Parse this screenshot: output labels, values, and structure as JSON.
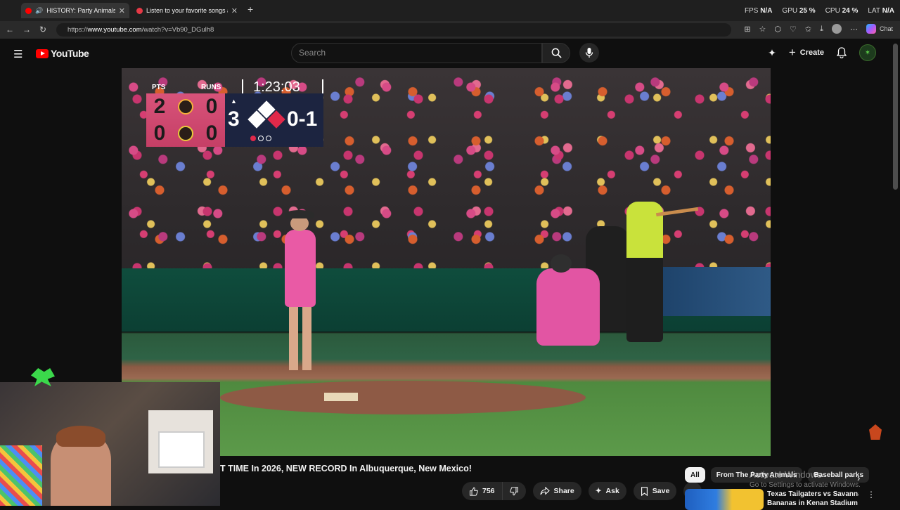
{
  "browser": {
    "tabs": [
      {
        "title": "HISTORY: Party Animals & Fir",
        "active": true
      },
      {
        "title": "Listen to your favorite songs and c",
        "active": false
      }
    ],
    "url_prefix": "https://",
    "url_host": "www.youtube.com",
    "url_path": "/watch?v=Vb90_DGulh8",
    "chat_label": "Chat",
    "stats": [
      {
        "label": "FPS",
        "value": "N/A"
      },
      {
        "label": "GPU",
        "value": "25 %"
      },
      {
        "label": "CPU",
        "value": "24 %"
      },
      {
        "label": "LAT",
        "value": "N/A"
      }
    ]
  },
  "youtube": {
    "logo_text": "YouTube",
    "search_placeholder": "Search",
    "create_label": "Create"
  },
  "scoreboard": {
    "pts_label": "PTS",
    "runs_label": "RUNS",
    "clock": "1:23:03",
    "teams": [
      {
        "pts": "2",
        "runs": "0"
      },
      {
        "pts": "0",
        "runs": "0"
      }
    ],
    "inning": "3",
    "count": "0-1"
  },
  "video": {
    "title": "T TIME In 2026, NEW RECORD In Albuquerque, New Mexico!",
    "likes": "756",
    "share_label": "Share",
    "ask_label": "Ask",
    "save_label": "Save"
  },
  "chips": [
    "All",
    "From The Party Animals",
    "Baseball parks"
  ],
  "activate_windows": {
    "title": "Activate Windows",
    "subtitle": "Go to Settings to activate Windows."
  },
  "recommendation": {
    "title_line1": "Texas Tailgaters vs Savannah",
    "title_line2": "Bananas in Kenan Stadium at ..."
  }
}
